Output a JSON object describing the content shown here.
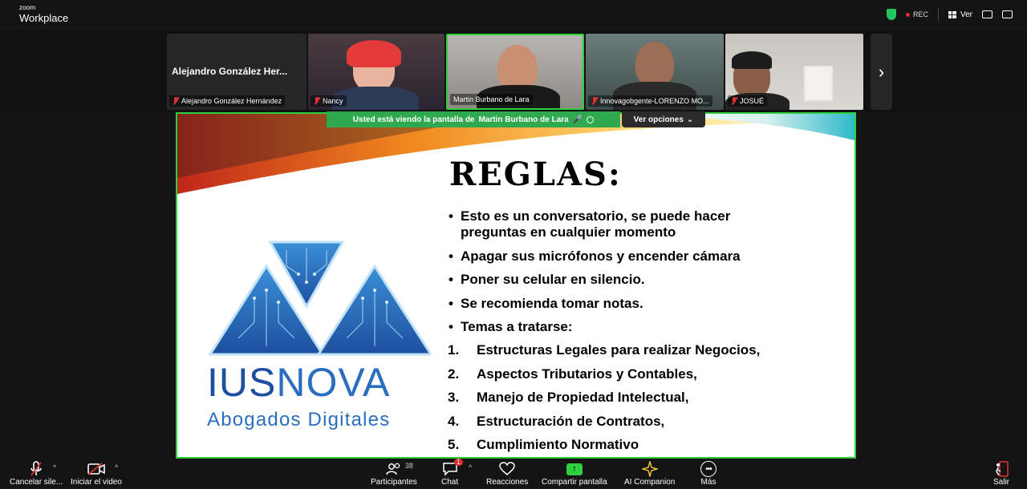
{
  "app": {
    "brand_small": "zoom",
    "brand_name": "Workplace"
  },
  "topbar": {
    "rec_label": "REC",
    "view_label": "Ver"
  },
  "participants_strip": [
    {
      "name": "Alejandro González Hernández",
      "big_name": "Alejandro González Her...",
      "muted": true
    },
    {
      "name": "Nancy",
      "muted": true
    },
    {
      "name": "Martin Burbano de Lara",
      "muted": false
    },
    {
      "name": "Innovagobgente-LORENZO MO...",
      "muted": true
    },
    {
      "name": "JOSUÉ",
      "muted": true
    }
  ],
  "share_banner": {
    "text": "Usted está viendo la pantalla de",
    "presenter": "Martin Burbano de Lara",
    "options_label": "Ver opciones"
  },
  "slide": {
    "title": "REGLAS:",
    "bullets": [
      "Esto es un conversatorio, se puede hacer preguntas en cualquier momento",
      "Apagar sus micrófonos y encender cámara",
      "Poner su celular en silencio.",
      "Se recomienda tomar notas.",
      "Temas a tratarse:"
    ],
    "topics": [
      {
        "n": "1.",
        "text": "Estructuras Legales para realizar Negocios,"
      },
      {
        "n": "2.",
        "text": "Aspectos Tributarios y Contables,"
      },
      {
        "n": "3.",
        "text": "Manejo de Propiedad Intelectual,"
      },
      {
        "n": "4.",
        "text": "Estructuración de Contratos,"
      },
      {
        "n": "5.",
        "text": "Cumplimiento Normativo"
      }
    ],
    "logo_part1": "IUS",
    "logo_part2": "NOVA",
    "logo_sub": "Abogados Digitales"
  },
  "toolbar": {
    "mute_label": "Cancelar sile...",
    "video_label": "Iniciar el video",
    "participants_label": "Participantes",
    "participants_count": "38",
    "chat_label": "Chat",
    "chat_badge": "1",
    "reactions_label": "Reacciones",
    "share_label": "Compartir pantalla",
    "ai_label": "AI Companion",
    "more_label": "Más",
    "leave_label": "Salir"
  },
  "colors": {
    "accent_green": "#2fcf3f",
    "banner_green": "#2fa84f",
    "mute_red": "#e03131",
    "logo_blue": "#2a6fbf"
  }
}
